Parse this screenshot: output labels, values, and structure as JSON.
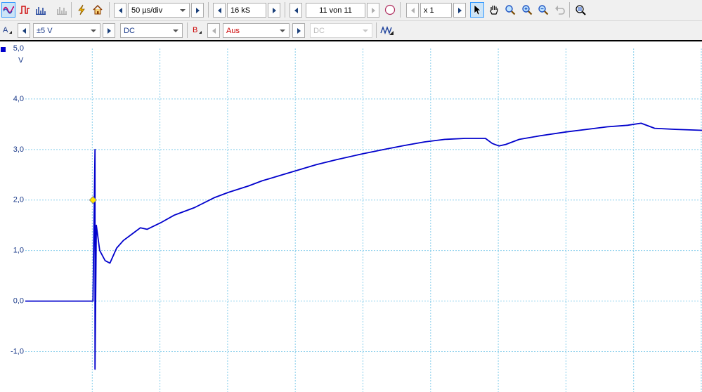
{
  "toolbar": {
    "timebase": "50 µs/div",
    "samples": "16 kS",
    "buffer": "11 von 11",
    "zoom": "x 1"
  },
  "channel_a": {
    "label": "A",
    "range": "±5 V",
    "coupling": "DC"
  },
  "channel_b": {
    "label": "B",
    "range": "Aus",
    "coupling": "DC"
  },
  "icons": {
    "scope_mode": "sine-wave-icon",
    "persistence_mode": "square-wave-icon",
    "spectrum_mode": "bar-spectrum-icon",
    "spectrum_mode_disabled": "bar-spectrum-disabled-icon",
    "autosetup": "lightning-icon",
    "default_setup": "home-icon",
    "rulers": "compass-icon",
    "select_tool": "arrow-pointer-icon",
    "pan_tool": "hand-icon",
    "zoom_area": "magnifier-icon",
    "zoom_in": "zoom-in-icon",
    "zoom_out": "zoom-out-icon",
    "undo_zoom": "undo-icon",
    "zoom_fit": "zoom-fit-icon",
    "trigger": "trigger-wave-icon"
  },
  "colors": {
    "trace": "#0000cc",
    "grid": "#87ceeb",
    "axis_text": "#1a3a8a",
    "channel_b": "#cc0000",
    "trigger_marker": "#ffe600"
  },
  "chart_data": {
    "type": "line",
    "y_unit": "V",
    "y_ticks": [
      "5,0",
      "4,0",
      "3,0",
      "2,0",
      "1,0",
      "0,0",
      "-1,0"
    ],
    "ylim": [
      -1.8,
      5.0
    ],
    "x_divisions": 10,
    "grid": true,
    "trigger_level": 2.0,
    "series": [
      {
        "points": [
          [
            0.0,
            0.0
          ],
          [
            0.4,
            0.0
          ],
          [
            0.8,
            0.0
          ],
          [
            1.0,
            0.0
          ],
          [
            1.03,
            3.0
          ],
          [
            1.03,
            -1.35
          ],
          [
            1.05,
            1.5
          ],
          [
            1.1,
            1.0
          ],
          [
            1.18,
            0.8
          ],
          [
            1.25,
            0.75
          ],
          [
            1.35,
            1.05
          ],
          [
            1.45,
            1.2
          ],
          [
            1.6,
            1.35
          ],
          [
            1.7,
            1.45
          ],
          [
            1.8,
            1.42
          ],
          [
            2.0,
            1.55
          ],
          [
            2.2,
            1.7
          ],
          [
            2.5,
            1.85
          ],
          [
            2.8,
            2.05
          ],
          [
            3.0,
            2.15
          ],
          [
            3.3,
            2.28
          ],
          [
            3.5,
            2.38
          ],
          [
            3.8,
            2.5
          ],
          [
            4.0,
            2.58
          ],
          [
            4.3,
            2.7
          ],
          [
            4.6,
            2.8
          ],
          [
            5.0,
            2.92
          ],
          [
            5.3,
            3.0
          ],
          [
            5.6,
            3.08
          ],
          [
            5.9,
            3.15
          ],
          [
            6.2,
            3.2
          ],
          [
            6.5,
            3.22
          ],
          [
            6.8,
            3.22
          ],
          [
            6.9,
            3.12
          ],
          [
            7.0,
            3.07
          ],
          [
            7.1,
            3.1
          ],
          [
            7.3,
            3.2
          ],
          [
            7.6,
            3.27
          ],
          [
            8.0,
            3.35
          ],
          [
            8.3,
            3.4
          ],
          [
            8.6,
            3.45
          ],
          [
            8.9,
            3.48
          ],
          [
            9.1,
            3.52
          ],
          [
            9.3,
            3.42
          ],
          [
            9.6,
            3.4
          ],
          [
            10.0,
            3.38
          ]
        ]
      }
    ]
  }
}
